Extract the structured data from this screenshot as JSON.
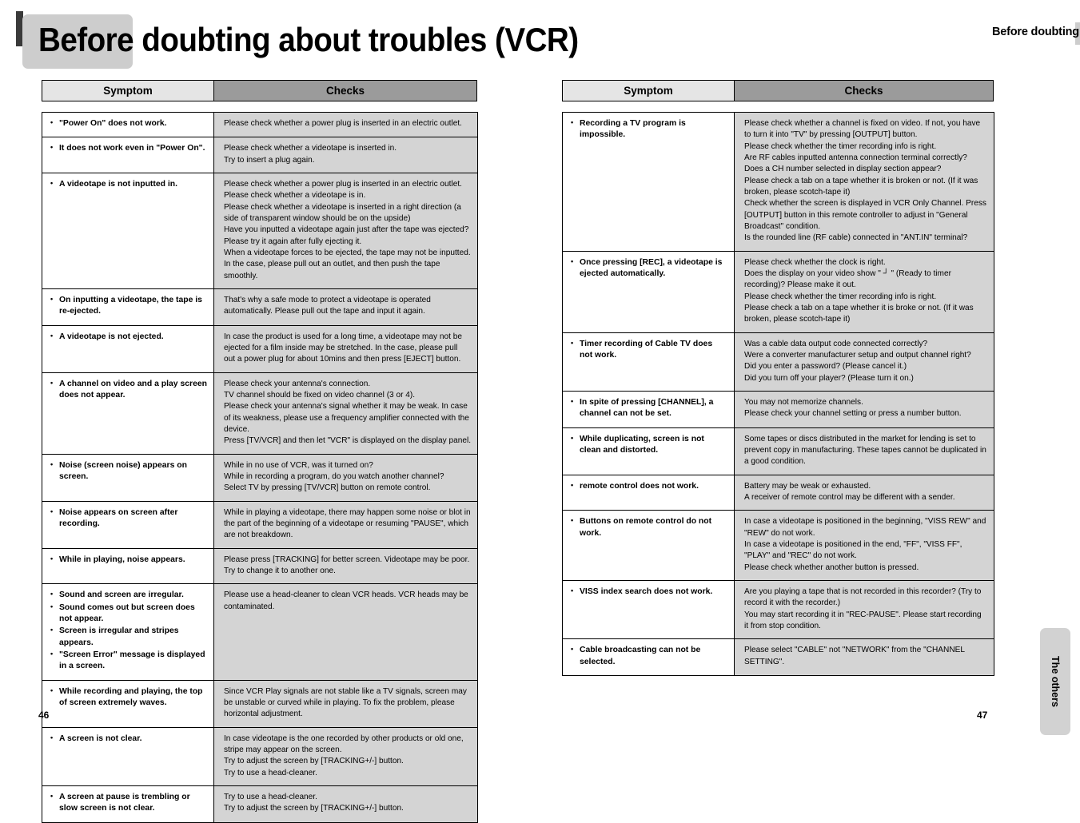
{
  "document": {
    "title": "Before doubting about troubles (VCR)",
    "running_header": "Before doubting about troubles (VCR)",
    "side_tab_label": "The others",
    "page_number_left": "46",
    "page_number_right": "47"
  },
  "table_headers": {
    "symptom": "Symptom",
    "checks": "Checks"
  },
  "left_table": {
    "rows": [
      {
        "symptoms": [
          "\"Power On\" does not work."
        ],
        "checks": [
          "Please check whether a power plug is inserted in an electric outlet."
        ]
      },
      {
        "symptoms": [
          "It does not work even in \"Power On\"."
        ],
        "checks": [
          "Please check whether a videotape is inserted in.",
          "Try to insert a plug again."
        ]
      },
      {
        "symptoms": [
          "A videotape is not inputted in."
        ],
        "checks": [
          "Please check whether a power plug is inserted in an electric outlet.",
          "Please check whether a videotape is in.",
          "Please check whether a videotape is inserted in a right direction (a side of transparent window should be on the upside)",
          "Have you inputted a videotape again just after the tape was ejected? Please try it again after fully ejecting it.",
          "When a videotape forces to be ejected, the tape may not be inputted. In the case, please pull out an outlet, and then push the tape smoothly."
        ]
      },
      {
        "symptoms": [
          "On inputting a videotape, the tape is re-ejected."
        ],
        "checks": [
          "That's why a safe mode to protect a videotape is operated automatically. Please pull out the tape and input it again."
        ]
      },
      {
        "symptoms": [
          "A videotape is not ejected."
        ],
        "checks": [
          "In case the product is used for a long time, a videotape may not be ejected for a film inside may be stretched. In the case, please pull out a power plug for about 10mins and then press [EJECT] button."
        ]
      },
      {
        "symptoms": [
          "A channel on video and a play screen does not appear."
        ],
        "checks": [
          "Please check your antenna's connection.",
          "TV channel should be fixed on video channel (3 or 4).",
          "Please check your antenna's signal whether it may be weak. In case of its weakness, please use a frequency amplifier connected with the device.",
          "Press [TV/VCR] and then let \"VCR\" is displayed on the display panel."
        ]
      },
      {
        "symptoms": [
          "Noise (screen noise) appears on screen."
        ],
        "checks": [
          "While in no use of VCR, was it turned on?",
          "While in recording a program, do you watch another channel?",
          "Select TV by pressing [TV/VCR] button on remote control."
        ]
      },
      {
        "symptoms": [
          "Noise appears on screen after recording."
        ],
        "checks": [
          "While in playing a videotape, there may happen some noise or blot in the part of the beginning of a videotape or resuming \"PAUSE\", which are not breakdown."
        ]
      },
      {
        "symptoms": [
          "While in playing, noise appears."
        ],
        "checks": [
          "Please press [TRACKING] for better screen. Videotape may be poor.",
          "Try to change it to another one."
        ]
      },
      {
        "symptoms": [
          "Sound and screen are irregular.",
          "Sound comes out but screen does not appear.",
          "Screen is irregular and stripes appears.",
          "\"Screen Error\" message is displayed in a screen."
        ],
        "checks": [
          "Please use a head-cleaner to clean VCR heads. VCR heads may be contaminated."
        ]
      },
      {
        "symptoms": [
          "While recording and playing, the top of screen extremely waves."
        ],
        "checks": [
          "Since VCR Play signals are not stable like a TV signals, screen may be unstable or curved while in playing. To fix the problem, please horizontal adjustment."
        ]
      },
      {
        "symptoms": [
          "A screen is not clear."
        ],
        "checks": [
          "In case videotape is the one recorded by other products or old one, stripe may appear on the screen.",
          "Try to adjust the screen by [TRACKING+/-] button.",
          "Try to use a head-cleaner."
        ]
      },
      {
        "symptoms": [
          "A screen at pause is trembling or slow screen is not clear."
        ],
        "checks": [
          "Try to use a head-cleaner.",
          "Try to adjust the screen by [TRACKING+/-] button."
        ]
      }
    ]
  },
  "right_table": {
    "rows": [
      {
        "symptoms": [
          "Recording a TV program is impossible."
        ],
        "checks": [
          "Please check whether a channel is fixed on video. If not, you have to turn it into \"TV\" by pressing [OUTPUT] button.",
          "Please check whether the timer recording info is right.",
          "Are RF cables inputted antenna connection terminal correctly?",
          "Does a CH number selected in display section appear?",
          "Please check a tab on a tape whether it is broken or not. (If it was broken, please scotch-tape it)",
          "Check whether the screen is displayed in VCR Only  Channel. Press [OUTPUT] button in this remote controller to adjust in \"General Broadcast\" condition.",
          "Is the rounded line (RF cable) connected in \"ANT.IN\" terminal?"
        ]
      },
      {
        "symptoms": [
          "Once pressing [REC], a videotape is ejected automatically."
        ],
        "checks": [
          "Please check whether the clock is right.",
          "Does the display on your video show \" ┘ \" (Ready to timer recording)? Please make it out.",
          "Please check whether the timer recording info is right.",
          "Please check a tab on a tape whether it is broke or not. (If it was broken, please scotch-tape it)"
        ]
      },
      {
        "symptoms": [
          "Timer recording of Cable TV does not work."
        ],
        "checks": [
          "Was a cable data output code connected correctly?",
          "Were a converter manufacturer setup and output channel right?",
          "Did you enter a password? (Please cancel it.)",
          "Did you turn off your player? (Please turn it on.)"
        ]
      },
      {
        "symptoms": [
          "In spite of pressing [CHANNEL], a channel can not be set."
        ],
        "checks": [
          "You may not memorize channels.",
          "Please check your channel setting or press a number button."
        ]
      },
      {
        "symptoms": [
          "While duplicating, screen is not clean and distorted."
        ],
        "checks": [
          "Some tapes or discs distributed in the  market for lending is set to prevent copy  in  manufacturing. These tapes cannot be duplicated in a good condition."
        ]
      },
      {
        "symptoms": [
          "remote control does not work."
        ],
        "checks": [
          "Battery may be weak or exhausted.",
          "A receiver of remote control may be different with a sender."
        ]
      },
      {
        "symptoms": [
          "Buttons on remote control do not work."
        ],
        "checks": [
          "In case a videotape is positioned in the beginning, \"VISS REW\" and \"REW\" do not work.",
          "In case a videotape is positioned in the end, \"FF\", \"VISS FF\", \"PLAY\" and \"REC\" do not work.",
          "Please check whether another button is pressed."
        ]
      },
      {
        "symptoms": [
          "VISS index search does not work."
        ],
        "checks": [
          "Are you playing a tape that is not recorded in this recorder?  (Try to record it with the recorder.)",
          "You may start recording it in \"REC-PAUSE\". Please start recording it from stop condition."
        ]
      },
      {
        "symptoms": [
          "Cable broadcasting can not be selected."
        ],
        "checks": [
          "Please select \"CABLE\" not \"NETWORK\" from the \"CHANNEL SETTING\"."
        ]
      }
    ]
  },
  "colors": {
    "header_symptom_bg": "#e5e5e5",
    "header_checks_bg": "#9b9b9b",
    "checks_cell_bg": "#d4d4d4",
    "title_box_bg": "#cdcdcd",
    "title_bar_dark": "#3a3a3a",
    "side_tab_bg": "#d2d2d2"
  }
}
